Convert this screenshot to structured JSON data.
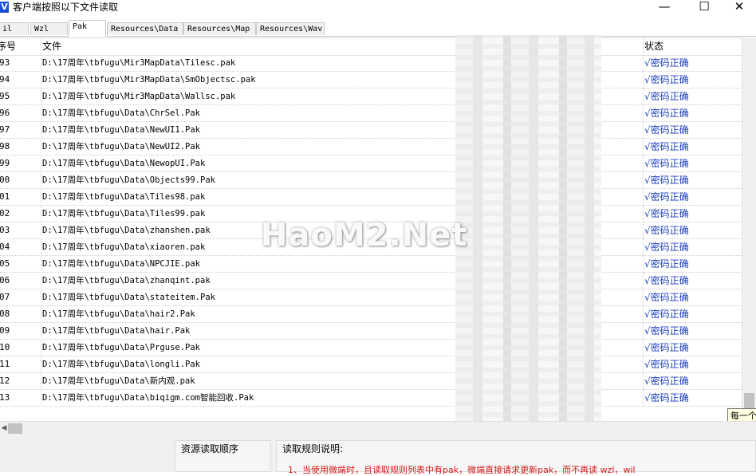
{
  "window": {
    "icon_letter": "V",
    "title": "客户端按照以下文件读取",
    "min_glyph": "—",
    "max_glyph": "☐",
    "close_glyph": "✕"
  },
  "tabs": [
    {
      "label": "il",
      "active": false
    },
    {
      "label": "Wzl",
      "active": false
    },
    {
      "label": "Pak",
      "active": true
    },
    {
      "label": "Resources\\Data",
      "active": false
    },
    {
      "label": "Resources\\Map",
      "active": false
    },
    {
      "label": "Resources\\Wav",
      "active": false
    }
  ],
  "table": {
    "headers": {
      "num": "序号",
      "file": "文件",
      "status": "状态"
    },
    "rows": [
      {
        "num": "93",
        "file": "D:\\17周年\\tbfugu\\Mir3MapData\\Tilesc.pak",
        "status": "√密码正确"
      },
      {
        "num": "94",
        "file": "D:\\17周年\\tbfugu\\Mir3MapData\\SmObjectsc.pak",
        "status": "√密码正确"
      },
      {
        "num": "95",
        "file": "D:\\17周年\\tbfugu\\Mir3MapData\\Wallsc.pak",
        "status": "√密码正确"
      },
      {
        "num": "96",
        "file": "D:\\17周年\\tbfugu\\Data\\ChrSel.Pak",
        "status": "√密码正确"
      },
      {
        "num": "97",
        "file": "D:\\17周年\\tbfugu\\Data\\NewUI1.Pak",
        "status": "√密码正确"
      },
      {
        "num": "98",
        "file": "D:\\17周年\\tbfugu\\Data\\NewUI2.Pak",
        "status": "√密码正确"
      },
      {
        "num": "99",
        "file": "D:\\17周年\\tbfugu\\Data\\NewopUI.Pak",
        "status": "√密码正确"
      },
      {
        "num": "00",
        "file": "D:\\17周年\\tbfugu\\Data\\Objects99.Pak",
        "status": "√密码正确"
      },
      {
        "num": "01",
        "file": "D:\\17周年\\tbfugu\\Data\\Tiles98.pak",
        "status": "√密码正确"
      },
      {
        "num": "02",
        "file": "D:\\17周年\\tbfugu\\Data\\Tiles99.pak",
        "status": "√密码正确"
      },
      {
        "num": "03",
        "file": "D:\\17周年\\tbfugu\\Data\\zhanshen.pak",
        "status": "√密码正确"
      },
      {
        "num": "04",
        "file": "D:\\17周年\\tbfugu\\Data\\xiaoren.pak",
        "status": "√密码正确"
      },
      {
        "num": "05",
        "file": "D:\\17周年\\tbfugu\\Data\\NPCJIE.pak",
        "status": "√密码正确"
      },
      {
        "num": "06",
        "file": "D:\\17周年\\tbfugu\\Data\\zhanqint.pak",
        "status": "√密码正确"
      },
      {
        "num": "07",
        "file": "D:\\17周年\\tbfugu\\Data\\stateitem.Pak",
        "status": "√密码正确"
      },
      {
        "num": "08",
        "file": "D:\\17周年\\tbfugu\\Data\\hair2.Pak",
        "status": "√密码正确"
      },
      {
        "num": "09",
        "file": "D:\\17周年\\tbfugu\\Data\\hair.Pak",
        "status": "√密码正确"
      },
      {
        "num": "10",
        "file": "D:\\17周年\\tbfugu\\Data\\Prguse.Pak",
        "status": "√密码正确"
      },
      {
        "num": "11",
        "file": "D:\\17周年\\tbfugu\\Data\\longli.Pak",
        "status": "√密码正确"
      },
      {
        "num": "12",
        "file": "D:\\17周年\\tbfugu\\Data\\新内观.pak",
        "status": "√密码正确"
      },
      {
        "num": "13",
        "file": "D:\\17周年\\tbfugu\\Data\\biqigm.com智能回收.Pak",
        "status": "√密码正确"
      }
    ]
  },
  "watermark": "HaoM2.Net",
  "tooltip": "每一个",
  "bottom": {
    "order_title": "资源读取顺序",
    "rules_title": "读取规则说明:",
    "rule_line": "1、当使用微端时，且读取规则列表中有pak，微端直接请求更新pak，而不再读 wzl，wil"
  },
  "colors": {
    "status_text": "#1c3fbf",
    "rule_text": "#d41a1a",
    "tooltip_bg": "#ffffe1"
  }
}
